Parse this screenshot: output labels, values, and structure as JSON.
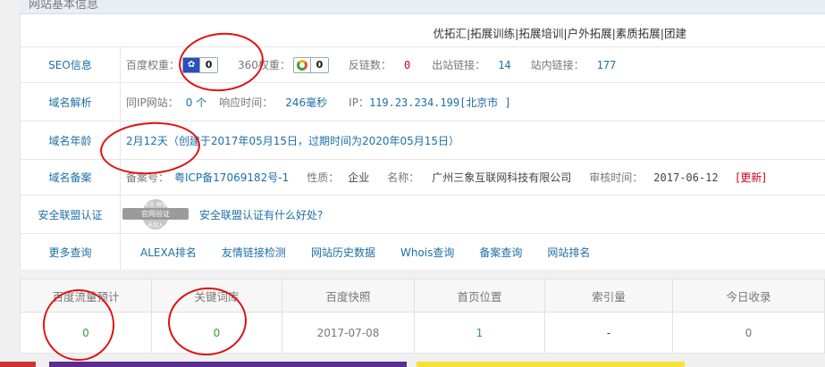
{
  "panel_title": "网站基本信息",
  "tagline": "优拓汇|拓展训练|拓展培训|户外拓展|素质拓展|团建",
  "rows": {
    "seo": {
      "label": "SEO信息",
      "baidu_weight_label": "百度权重：",
      "baidu_weight": "0",
      "w360_label": "360权重：",
      "w360": "0",
      "backlinks_label": "反链数：",
      "backlinks": "0",
      "outlinks_label": "出站链接：",
      "outlinks": "14",
      "inlinks_label": "站内链接：",
      "inlinks": "177"
    },
    "dns": {
      "label": "域名解析",
      "same_ip_label": "同IP网站：",
      "same_ip": "0 个",
      "resp_label": "响应时间：",
      "resp": "246毫秒",
      "ip_label": "IP：",
      "ip": "119.23.234.199[北京市 ]"
    },
    "age": {
      "label": "域名年龄",
      "text": "2月12天（创建于2017年05月15日，过期时间为2020年05月15日）"
    },
    "icp": {
      "label": "域名备案",
      "no_label": "备案号：",
      "no": "粤ICP备17069182号-1",
      "nature_label": "性质：",
      "nature": "企业",
      "name_label": "名称：",
      "name": "广州三象互联网科技有限公司",
      "audit_label": "审核时间：",
      "audit": "2017-06-12",
      "update": "[更新]"
    },
    "security": {
      "label": "安全联盟认证",
      "seal_top": "安全  联盟",
      "seal_mid": "官网验证",
      "seal_bot": "未加入",
      "link": "安全联盟认证有什么好处?"
    },
    "more": {
      "label": "更多查询",
      "links": [
        "ALEXA排名",
        "友情链接检测",
        "网站历史数据",
        "Whois查询",
        "备案查询",
        "网站排名"
      ]
    }
  },
  "stats": {
    "headers": [
      "百度流量预计",
      "关键词库",
      "百度快照",
      "首页位置",
      "索引量",
      "今日收录"
    ],
    "values": [
      "0",
      "0",
      "2017-07-08",
      "1",
      "-",
      "0"
    ]
  },
  "colors": {
    "link": "#1d6fa5",
    "alert": "#d0021b",
    "annotation": "#e01010"
  }
}
